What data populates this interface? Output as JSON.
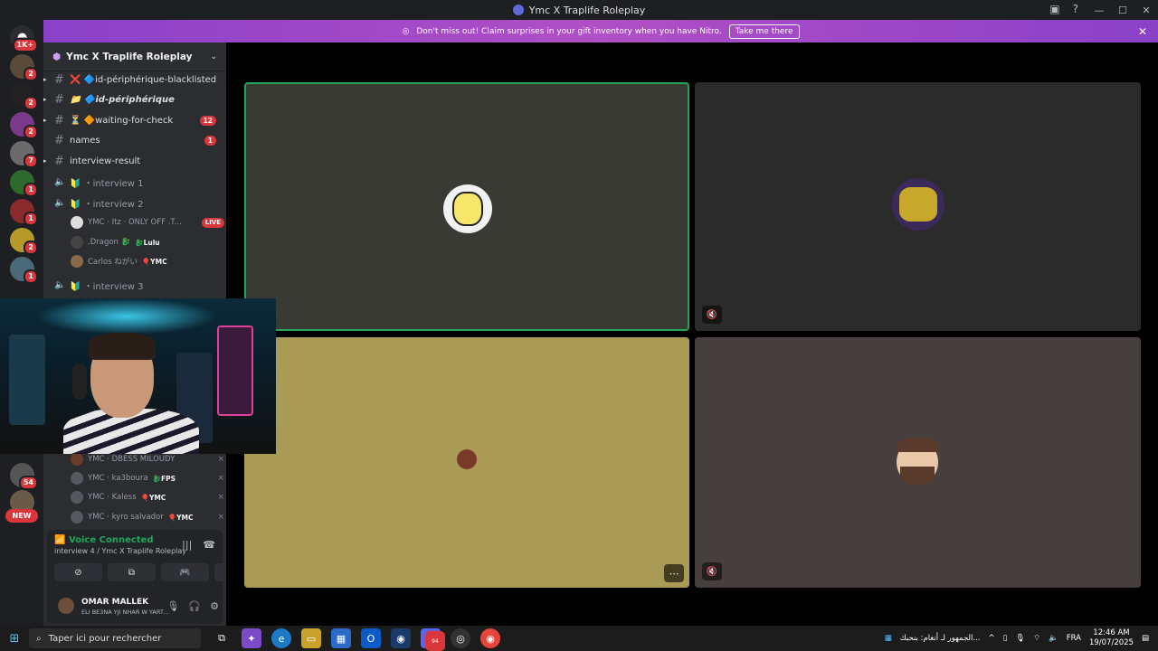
{
  "window": {
    "title": "Ymc X Traplife Roleplay",
    "controls": [
      "—",
      "☐",
      "✕"
    ]
  },
  "guilds": {
    "badges": [
      "1K+",
      "2",
      "2",
      "2",
      "7",
      "1",
      "1",
      "2",
      "1",
      "54"
    ],
    "new_label": "NEW"
  },
  "nitro_banner": {
    "text": "Don't miss out! Claim surprises in your gift inventory when you have Nitro.",
    "button": "Take me there"
  },
  "sidebar": {
    "server_name": "Ymc X Traplife Roleplay",
    "channels": [
      {
        "name": "❌ 🔷id-périphérique-blacklisted",
        "count": ""
      },
      {
        "name": "📁 🔷id-périphérique",
        "count": ""
      },
      {
        "name": "⏳ 🔶waiting-for-check",
        "count": "12"
      },
      {
        "name": "names",
        "count": "1"
      },
      {
        "name": "interview-result",
        "count": ""
      }
    ],
    "voice_channels": [
      {
        "name": "🔰 ・interview 1"
      },
      {
        "name": "🔰 ・interview 2"
      },
      {
        "name": "🔰 ・interview 3"
      }
    ],
    "interview2_members": [
      {
        "name": "YMC · Itz · ONLY OFF .T...",
        "tag": "",
        "live": "LIVE"
      },
      {
        "name": ".Dragon 🐉",
        "tag": "🐉Lulu",
        "live": ""
      },
      {
        "name": "Carlos ねがい",
        "tag": "🎈YMC",
        "live": ""
      }
    ],
    "interview4_members": [
      {
        "name": "YMC · DBESS MILOUDY",
        "tag": ""
      },
      {
        "name": "YMC · ka3boura",
        "tag": "🐉FPS"
      },
      {
        "name": "YMC · Kaless",
        "tag": "🎈YMC"
      },
      {
        "name": "YMC · kyro salvador",
        "tag": "🎈YMC"
      }
    ]
  },
  "voice_panel": {
    "status": "Voice Connected",
    "location": "interview 4 / Ymc X Traplife Roleplay"
  },
  "user": {
    "name": "OMAR MALLEK",
    "status": "ELI BE3NA YJI NHAR W YART..."
  },
  "taskbar": {
    "search_placeholder": "Taper ici pour rechercher",
    "news": "الجمهور لـ أنغام: بنحبك...",
    "lang": "FRA",
    "time": "12:46 AM",
    "date": "19/07/2025",
    "discord_badge": "94"
  },
  "colors": {
    "accent_green": "#23a55a",
    "danger_red": "#da373c",
    "nitro_purple": "#b04fc6",
    "tile_speaking": "#3a3a35",
    "tile_gold": "#a99a55",
    "tile_dark": "#2b2b2c",
    "tile_brown": "#463f3e"
  }
}
